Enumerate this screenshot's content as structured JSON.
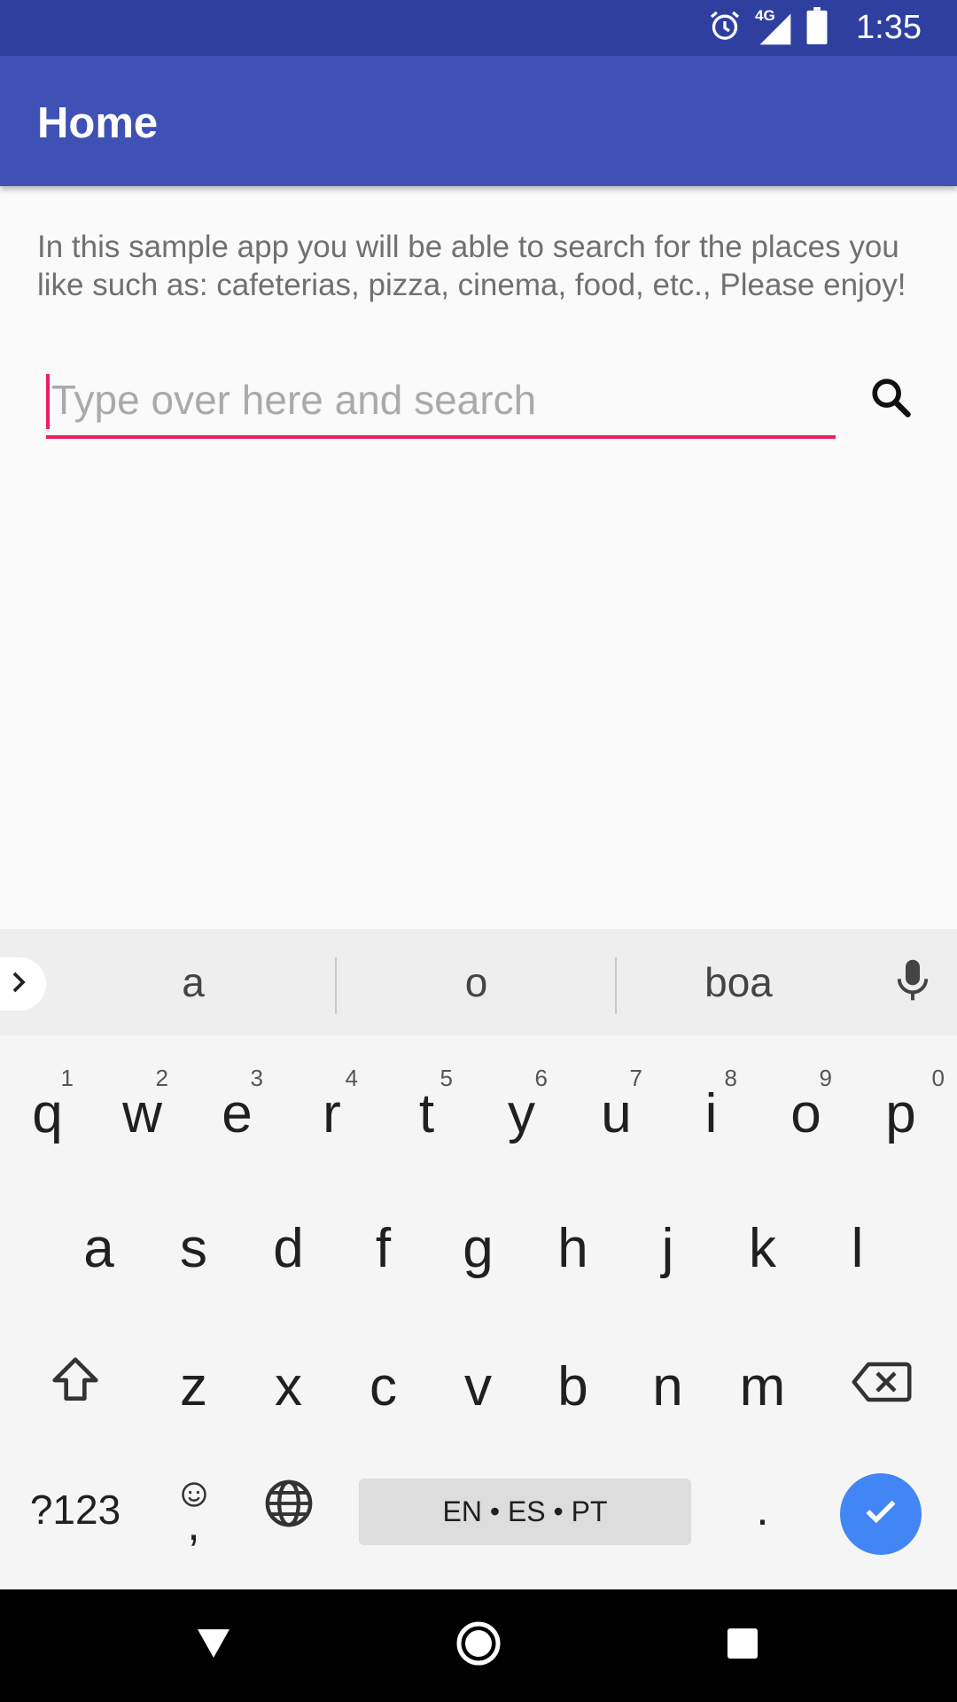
{
  "status_bar": {
    "time": "1:35",
    "network": "4G"
  },
  "app_bar": {
    "title": "Home"
  },
  "description": "In this sample app you will be able to search for the places you like such as: cafeterias, pizza, cinema, food, etc., Please enjoy!",
  "search": {
    "placeholder": "Type over here and search",
    "value": ""
  },
  "keyboard": {
    "suggestions": [
      "a",
      "o",
      "boa"
    ],
    "row1": [
      "q",
      "w",
      "e",
      "r",
      "t",
      "y",
      "u",
      "i",
      "o",
      "p"
    ],
    "row1_hints": [
      "1",
      "2",
      "3",
      "4",
      "5",
      "6",
      "7",
      "8",
      "9",
      "0"
    ],
    "row2": [
      "a",
      "s",
      "d",
      "f",
      "g",
      "h",
      "j",
      "k",
      "l"
    ],
    "row3": [
      "z",
      "x",
      "c",
      "v",
      "b",
      "n",
      "m"
    ],
    "symbols_label": "?123",
    "comma": ",",
    "space_label": "EN • ES • PT",
    "period": "."
  },
  "colors": {
    "status_bar": "#2f3f9f",
    "app_bar": "#3f51b5",
    "accent": "#e91e63",
    "enter_key": "#4285f4"
  }
}
